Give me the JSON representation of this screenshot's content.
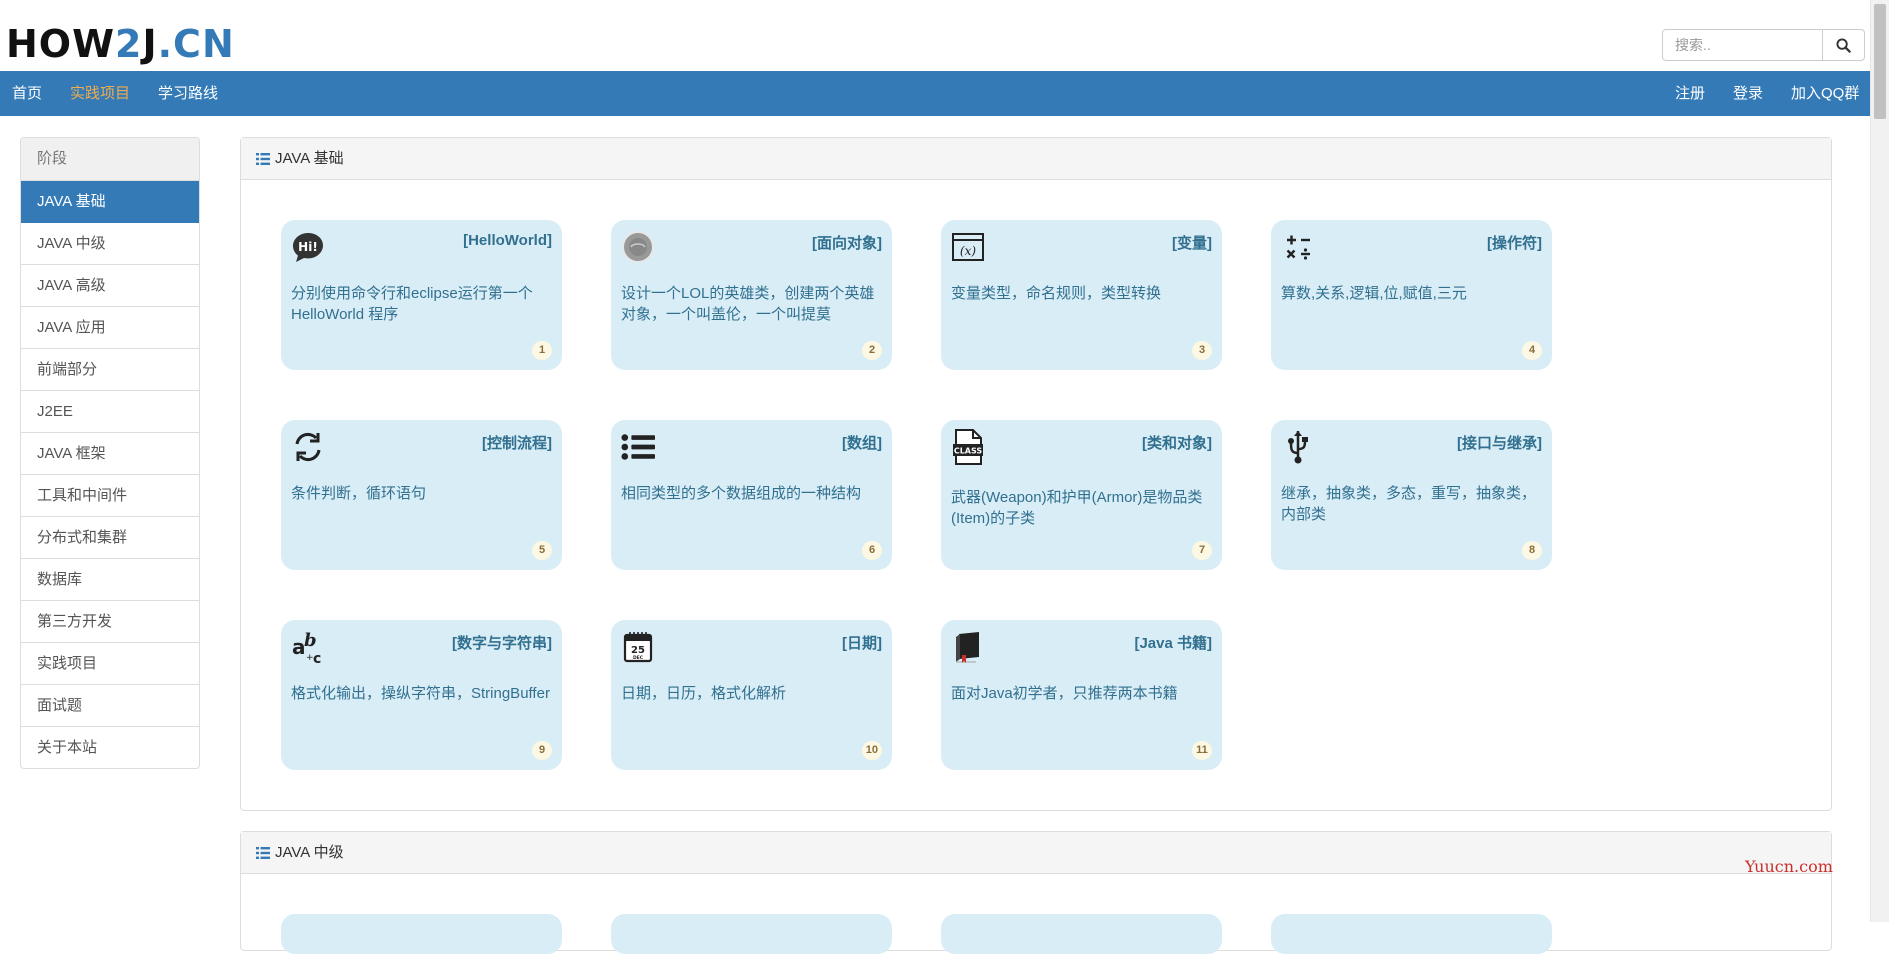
{
  "logo": {
    "part1": "HOW",
    "part2": "2",
    "part3": "J",
    "part4": ".CN"
  },
  "search": {
    "placeholder": "搜索.."
  },
  "nav": {
    "left": [
      "首页",
      "实践项目",
      "学习路线"
    ],
    "right": [
      "注册",
      "登录",
      "加入QQ群"
    ]
  },
  "sidebar": {
    "header": "阶段",
    "items": [
      "JAVA 基础",
      "JAVA 中级",
      "JAVA 高级",
      "JAVA 应用",
      "前端部分",
      "J2EE",
      "JAVA 框架",
      "工具和中间件",
      "分布式和集群",
      "数据库",
      "第三方开发",
      "实践项目",
      "面试题",
      "关于本站"
    ]
  },
  "sections": [
    {
      "title": "JAVA 基础"
    },
    {
      "title": "JAVA 中级"
    }
  ],
  "cards": [
    {
      "title": "[HelloWorld]",
      "desc": "分别使用命令行和eclipse运行第一个HelloWorld 程序",
      "num": "1",
      "icon": "hi-speech-bubble-icon"
    },
    {
      "title": "[面向对象]",
      "desc": "设计一个LOL的英雄类，创建两个英雄对象，一个叫盖伦，一个叫提莫",
      "num": "2",
      "icon": "lol-hero-avatar-icon"
    },
    {
      "title": "[变量]",
      "desc": "变量类型，命名规则，类型转换",
      "num": "3",
      "icon": "variable-x-icon"
    },
    {
      "title": "[操作符]",
      "desc": "算数,关系,逻辑,位,赋值,三元",
      "num": "4",
      "icon": "math-operators-icon"
    },
    {
      "title": "[控制流程]",
      "desc": "条件判断，循环语句",
      "num": "5",
      "icon": "loop-arrows-icon"
    },
    {
      "title": "[数组]",
      "desc": "相同类型的多个数据组成的一种结构",
      "num": "6",
      "icon": "list-icon"
    },
    {
      "title": "[类和对象]",
      "desc": "武器(Weapon)和护甲(Armor)是物品类(Item)的子类",
      "num": "7",
      "icon": "class-file-icon"
    },
    {
      "title": "[接口与继承]",
      "desc": "继承，抽象类，多态，重写，抽象类，内部类",
      "num": "8",
      "icon": "usb-icon"
    },
    {
      "title": "[数字与字符串]",
      "desc": "格式化输出，操纵字符串，StringBuffer",
      "num": "9",
      "icon": "abc-letters-icon"
    },
    {
      "title": "[日期]",
      "desc": "日期，日历，格式化解析",
      "num": "10",
      "icon": "calendar-icon"
    },
    {
      "title": "[Java 书籍]",
      "desc": "面对Java初学者，只推荐两本书籍",
      "num": "11",
      "icon": "book-icon"
    }
  ],
  "watermark": "Yuucn.com",
  "colors": {
    "primary": "#337ab7",
    "active_nav": "#f0ad4e",
    "card_bg": "#d9edf7",
    "card_text": "#31708f",
    "badge_bg": "#fcf8e3",
    "badge_text": "#8a6d3b",
    "watermark": "#c9302c"
  }
}
